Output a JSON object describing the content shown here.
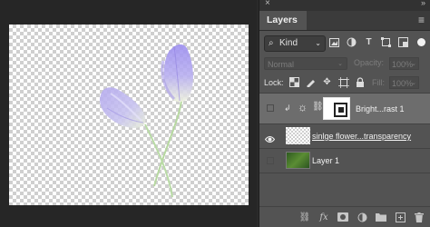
{
  "panel": {
    "close_glyph": "×",
    "collapse_glyph": "»",
    "tab_label": "Layers",
    "menu_glyph": "≡"
  },
  "filter": {
    "kind_label": "Kind",
    "icons": [
      "image-filter-icon",
      "adjustment-filter-icon",
      "type-filter-icon",
      "shape-filter-icon",
      "smartobject-filter-icon",
      "filter-toggle"
    ]
  },
  "blend": {
    "mode": "Normal",
    "opacity_label": "Opacity:",
    "opacity_value": "100%",
    "lock_label": "Lock:",
    "fill_label": "Fill:",
    "fill_value": "100%"
  },
  "layers": [
    {
      "name": "Bright...rast 1",
      "type": "adjustment",
      "visible": false,
      "selected": true
    },
    {
      "name": "sinlge flower...transparency",
      "type": "pixel",
      "visible": true,
      "selected": false
    },
    {
      "name": "Layer 1",
      "type": "pixel",
      "visible": false,
      "selected": false
    }
  ],
  "bottom_icons": [
    "link-layers-icon",
    "fx-icon",
    "add-mask-icon",
    "new-adjustment-icon",
    "new-group-icon",
    "new-layer-icon",
    "delete-layer-icon"
  ],
  "colors": {
    "panel_bg": "#535353",
    "selected_layer": "#6d6d6d",
    "petal": "#a99fe8"
  }
}
